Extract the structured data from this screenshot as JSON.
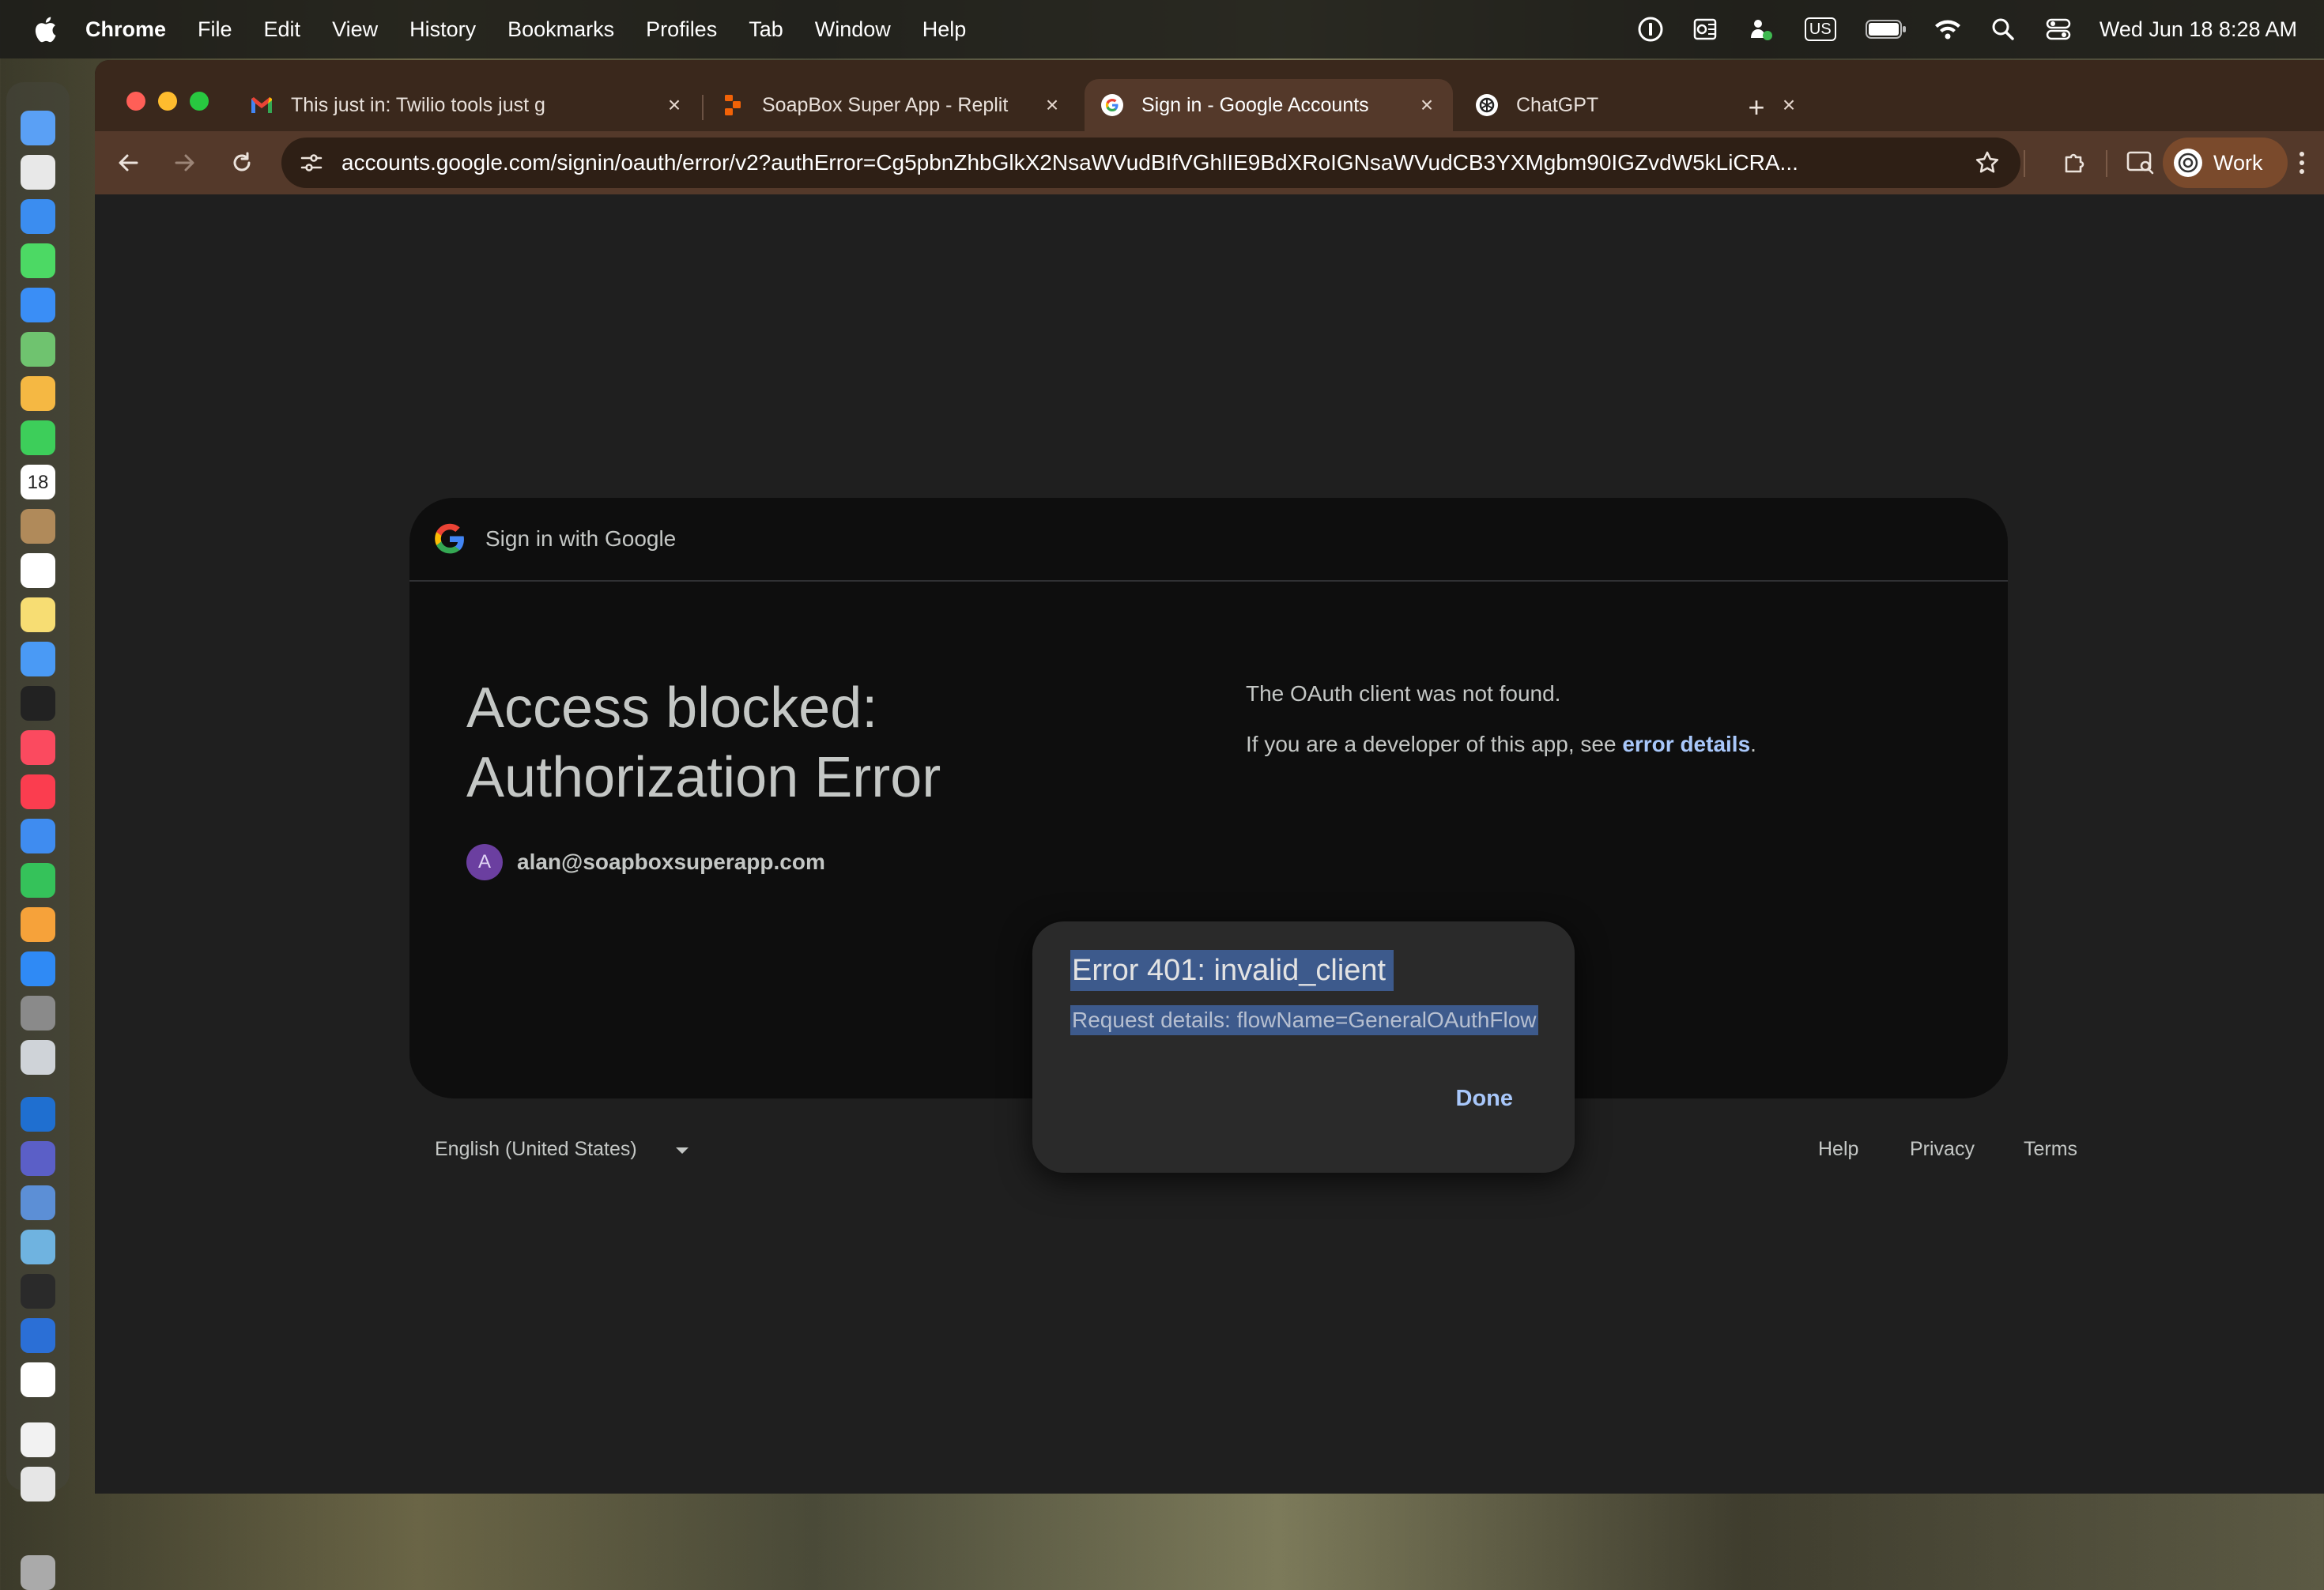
{
  "menubar": {
    "apple_icon": "apple-logo-icon",
    "items": [
      "Chrome",
      "File",
      "Edit",
      "View",
      "History",
      "Bookmarks",
      "Profiles",
      "Tab",
      "Window",
      "Help"
    ],
    "input_source": "US",
    "clock": "Wed Jun 18  8:28 AM"
  },
  "dock": {
    "icons": [
      "finder-icon",
      "launchpad-icon",
      "safari-icon",
      "messages-icon",
      "mail-icon",
      "maps-icon",
      "photos-icon",
      "facetime-icon",
      "calendar-icon",
      "contacts-icon",
      "reminders-icon",
      "notes-icon",
      "freeform-icon",
      "tv-icon",
      "music-icon",
      "news-icon",
      "keynote-icon",
      "numbers-icon",
      "pages-icon",
      "app-store-icon",
      "system-settings-icon",
      "iphone-mirroring-icon",
      "outlook-icon",
      "teams-icon",
      "preview-icon",
      "maps-alt-icon",
      "terminal-icon",
      "1password-icon",
      "chrome-icon",
      "document-icon",
      "files-icon",
      "trash-icon"
    ],
    "calendar_day": "18"
  },
  "tabs": [
    {
      "title": "This just in: Twilio tools just g",
      "favicon": "gmail-icon",
      "active": false
    },
    {
      "title": "SoapBox Super App - Replit",
      "favicon": "replit-icon",
      "active": false
    },
    {
      "title": "Sign in - Google Accounts",
      "favicon": "google-icon",
      "active": true
    },
    {
      "title": "ChatGPT",
      "favicon": "chatgpt-icon",
      "active": false
    }
  ],
  "toolbar": {
    "url": "accounts.google.com/signin/oauth/error/v2?authError=Cg5pbnZhbGlkX2NsaWVudBIfVGhlIE9BdXRoIGNsaWVudCB3YXMgbm90IGZvdW5kLiCRA...",
    "profile_label": "Work"
  },
  "page": {
    "header": "Sign in with Google",
    "headline_line1": "Access blocked:",
    "headline_line2": "Authorization Error",
    "avatar_initial": "A",
    "email": "alan@soapboxsuperapp.com",
    "oauth_message": "The OAuth client was not found.",
    "details_prefix": "If you are a developer of this app, see ",
    "details_link": "error details",
    "details_suffix": "."
  },
  "dialog": {
    "title": "Error 401: invalid_client",
    "details": "Request details: flowName=GeneralOAuthFlow",
    "done_label": "Done"
  },
  "footer": {
    "language": "English (United States)",
    "help": "Help",
    "privacy": "Privacy",
    "terms": "Terms"
  },
  "colors": {
    "tab_strip": "#3a281c",
    "toolbar": "#54392a",
    "page_bg": "#1f1f1f",
    "card_bg": "#0e0e0e",
    "link": "#a8c7fa",
    "selection": "#3d5a8c"
  }
}
